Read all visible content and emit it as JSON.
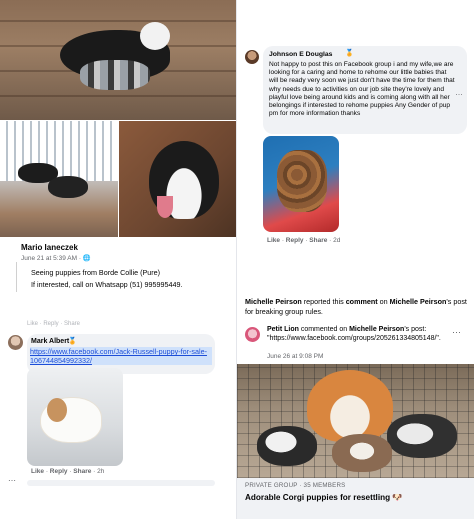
{
  "q1": {
    "comment": {
      "author": "Mario Ianeczek",
      "meta": "June 21 at 5:39 AM · 🌐",
      "line1": "Seeing puppies from Borde Collie (Pure)",
      "line2": "If interested, call on Whatsapp (51) 995995449."
    }
  },
  "q2": {
    "author": "Johnson E Douglas",
    "badge": "🏅",
    "body": "Not happy to post this on Facebook group i and my wife,we are looking for a caring and home to rehome our little babies that will be ready very soon we just don't have the time for them that why needs due to activities on our job site they're lovely and playful love being around kids and is coming along with all her belongings if interested to rehome puppies Any Gender of pup pm for more information thanks",
    "more": "…",
    "actions": {
      "like": "Like",
      "reply": "Reply",
      "share": "Share",
      "time": "2d"
    }
  },
  "q3": {
    "topcut": "Like · Reply · Share",
    "author": "Mark Albert",
    "badge": "🏅",
    "link": "https://www.facebook.com/Jack-Russell-puppy-for-sale-106744854992332/",
    "actions": {
      "like": "Like",
      "reply": "Reply",
      "share": "Share",
      "time": "2h"
    },
    "dots": "⋯"
  },
  "q4": {
    "report_name1": "Michelle Peirson",
    "report_mid": " reported this ",
    "report_comment": "comment",
    "report_on": " on ",
    "report_name2": "Michelle Peirson",
    "report_tail": "'s post for breaking group rules.",
    "commenter": "Petit Lion",
    "commented_on": " commented on ",
    "post_owner": "Michelle Peirson",
    "post_tail": "'s post:",
    "comment_text": "\"https://www.facebook.com/groups/205261334805148/\".",
    "menu": "⋯",
    "time": "June 26 at 9:08 PM",
    "group_meta": "PRIVATE GROUP · 35 MEMBERS",
    "group_name": "Adorable Corgi puppies for resettling 🐶"
  }
}
